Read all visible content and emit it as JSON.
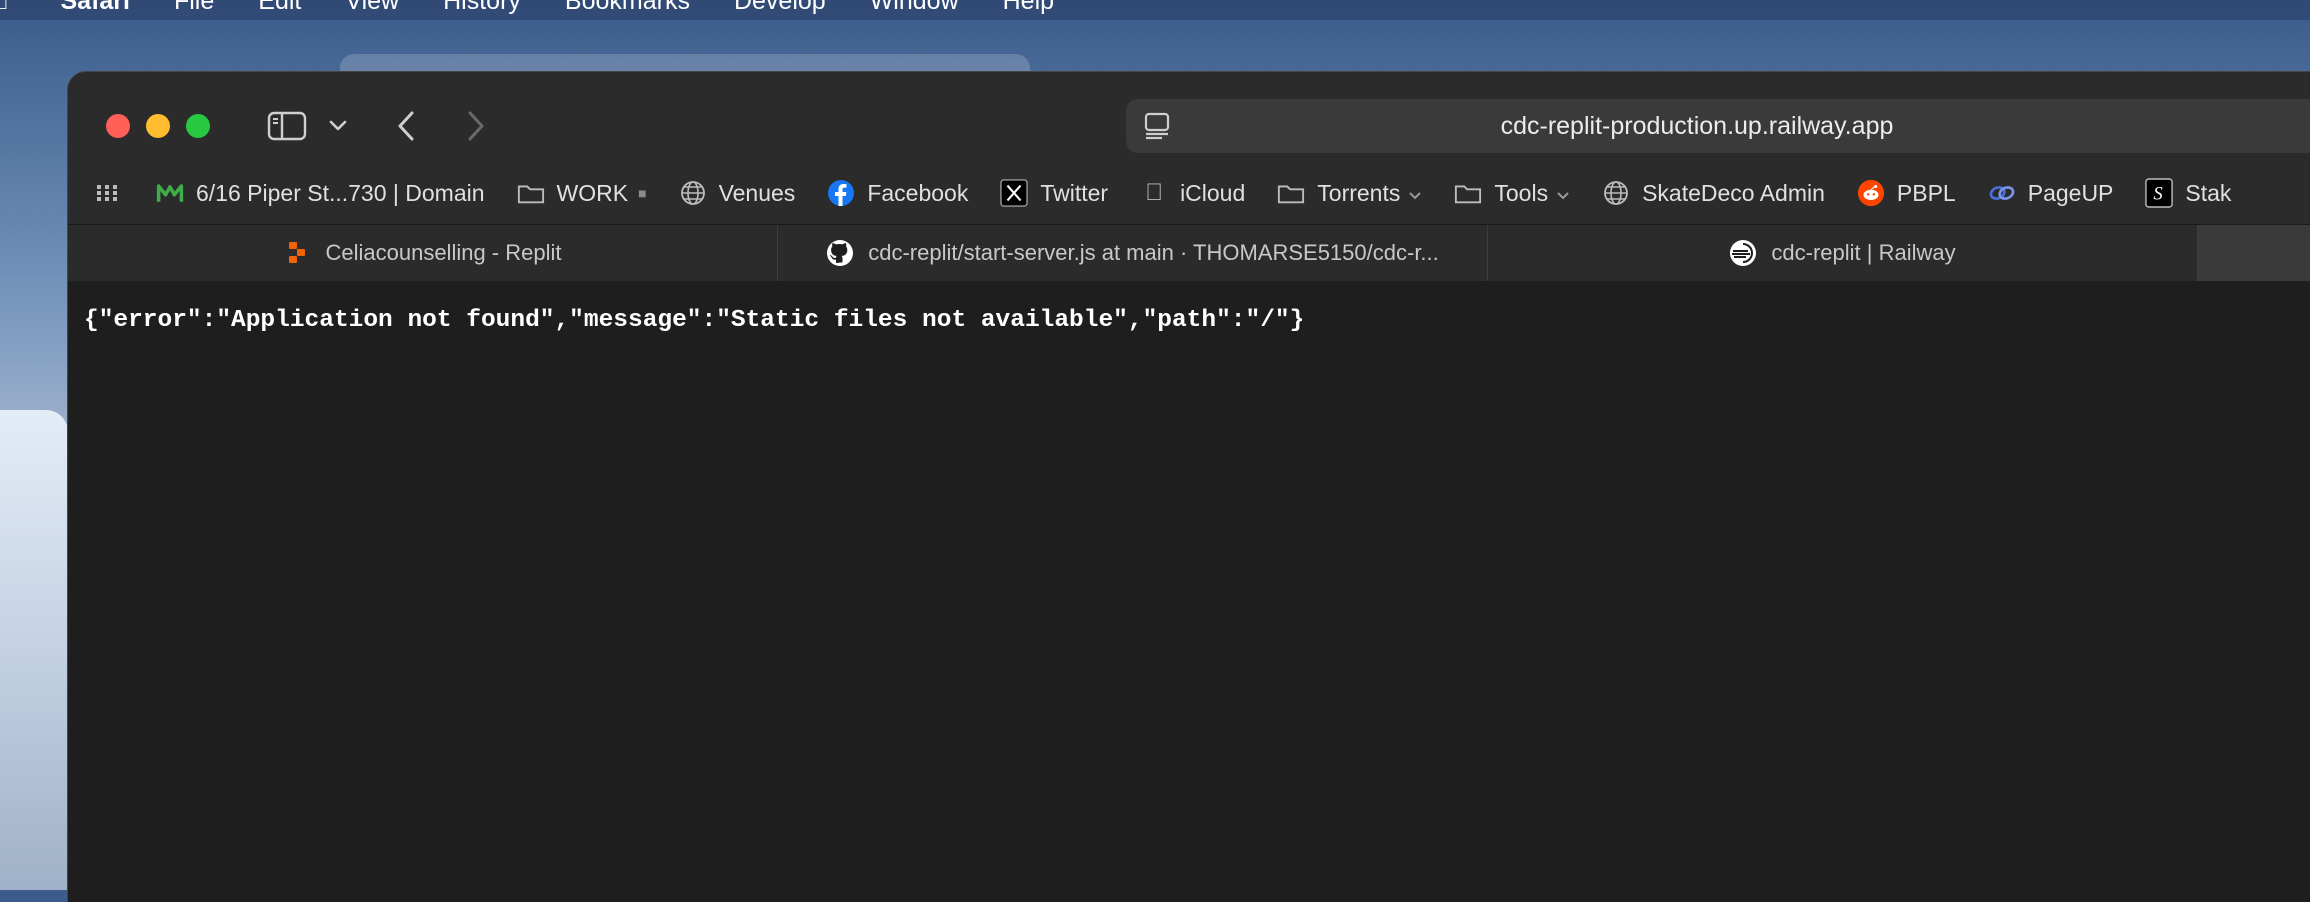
{
  "menubar": {
    "app_name": "Safari",
    "items": [
      "File",
      "Edit",
      "View",
      "History",
      "Bookmarks",
      "Develop",
      "Window",
      "Help"
    ]
  },
  "window": {
    "address_bar": {
      "url": "cdc-replit-production.up.railway.app"
    },
    "bookmarks": [
      {
        "label": "6/16 Piper St...730 | Domain",
        "icon": "domain-m-icon",
        "color": "#3fae49"
      },
      {
        "label": "WORK",
        "icon": "folder-icon",
        "badge": "■"
      },
      {
        "label": "Venues",
        "icon": "globe-icon"
      },
      {
        "label": "Facebook",
        "icon": "facebook-icon",
        "color": "#1877f2"
      },
      {
        "label": "Twitter",
        "icon": "x-logo-icon"
      },
      {
        "label": "iCloud",
        "icon": "apple-icon"
      },
      {
        "label": "Torrents",
        "icon": "folder-icon",
        "dropdown": true
      },
      {
        "label": "Tools",
        "icon": "folder-icon",
        "dropdown": true
      },
      {
        "label": "SkateDeco Admin",
        "icon": "globe-icon"
      },
      {
        "label": "PBPL",
        "icon": "reddit-icon",
        "color": "#ff4500"
      },
      {
        "label": "PageUP",
        "icon": "pageup-link-icon",
        "color": "#4a6fd8"
      },
      {
        "label": "Stak",
        "icon": "stak-icon"
      }
    ],
    "tabs": [
      {
        "title": "Celiacounselling - Replit",
        "icon": "replit-icon",
        "color": "#f26207"
      },
      {
        "title": "cdc-replit/start-server.js at main · THOMARSE5150/cdc-r...",
        "icon": "github-icon"
      },
      {
        "title": "cdc-replit | Railway",
        "icon": "railway-icon"
      }
    ],
    "page_body": "{\"error\":\"Application not found\",\"message\":\"Static files not available\",\"path\":\"/\"}"
  }
}
